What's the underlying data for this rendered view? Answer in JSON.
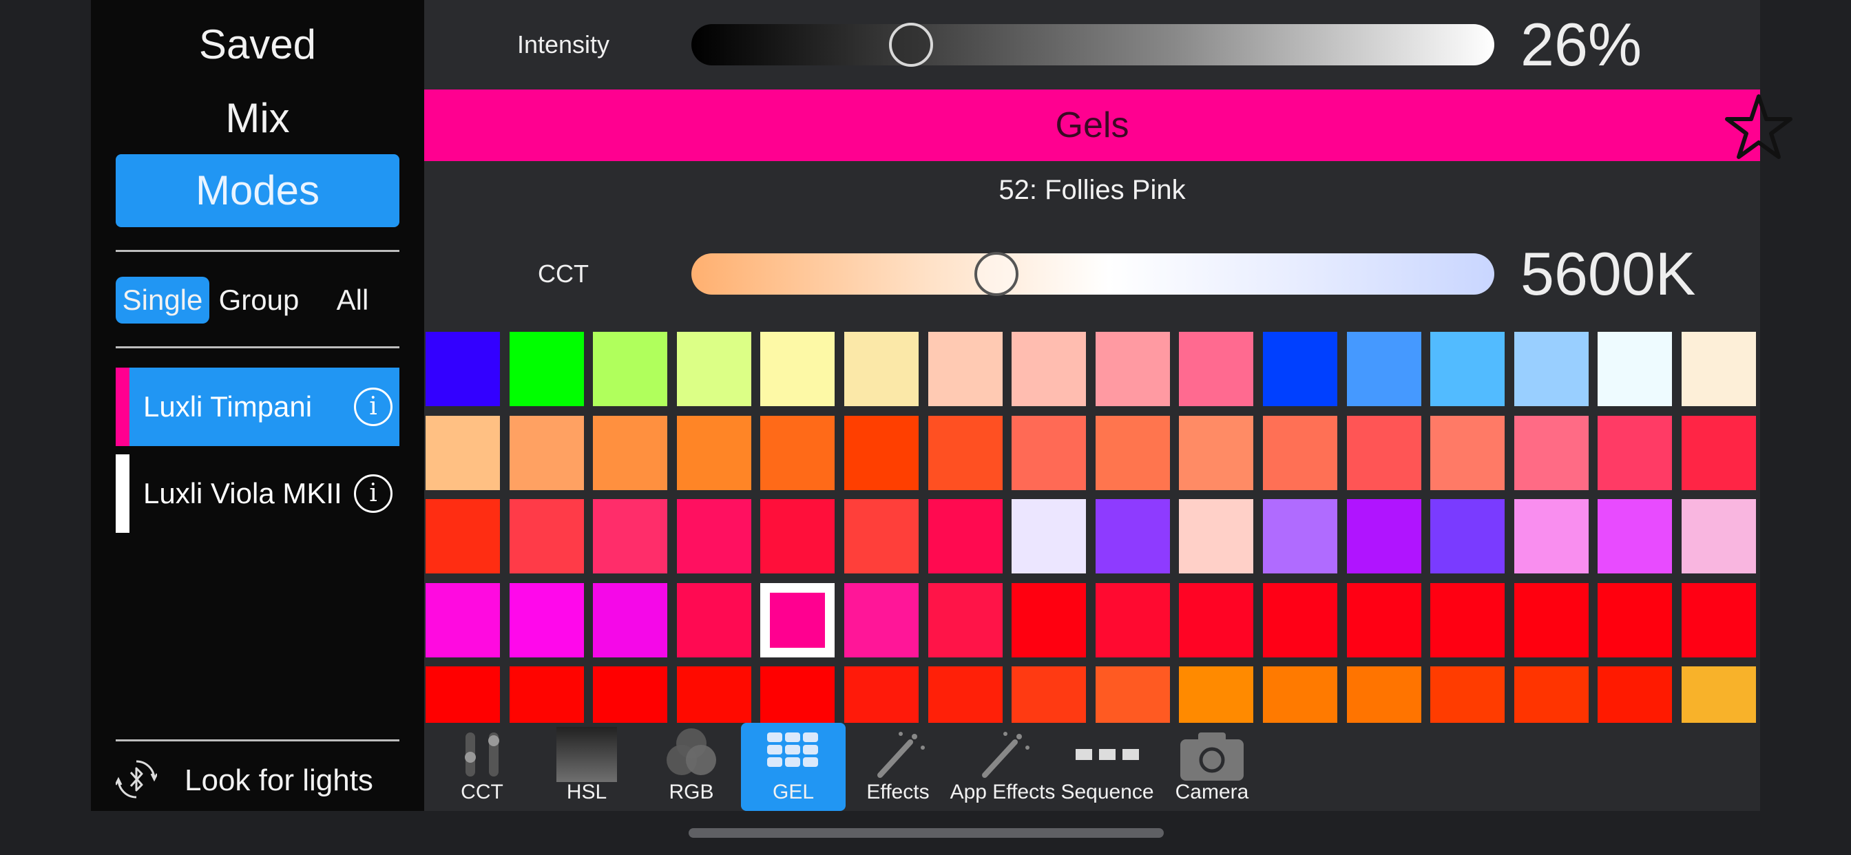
{
  "sidebar": {
    "nav": [
      {
        "label": "Saved",
        "active": false
      },
      {
        "label": "Mix",
        "active": false
      },
      {
        "label": "Modes",
        "active": true
      }
    ],
    "scope": [
      {
        "label": "Single",
        "active": true
      },
      {
        "label": "Group",
        "active": false
      },
      {
        "label": "All",
        "active": false
      }
    ],
    "lights": [
      {
        "name": "Luxli Timpani",
        "strip_color": "#ff0090",
        "selected": true
      },
      {
        "name": "Luxli Viola MKII",
        "strip_color": "#ffffff",
        "selected": false
      }
    ],
    "look_for_lights": "Look for lights",
    "info_glyph": "i"
  },
  "intensity": {
    "label": "Intensity",
    "value_text": "26%",
    "value": 0.26
  },
  "gels": {
    "title": "Gels",
    "selected_name": "52: Follies Pink",
    "favorite_icon": "star-outline-icon",
    "bar_color": "#ff0090"
  },
  "cct": {
    "label": "CCT",
    "value_text": "5600K",
    "value": 0.37
  },
  "swatches": [
    [
      "#3300ff",
      "#00ff00",
      "#b0ff5c",
      "#dcff86",
      "#fdf9a6",
      "#fbe8a8",
      "#ffcab3",
      "#ffbdb0",
      "#ff9aa2",
      "#ff6a90",
      "#0040ff",
      "#4599ff",
      "#52bbff",
      "#99cfff",
      "#eefbff",
      "#fdefd8"
    ],
    [
      "#ffc083",
      "#ffa162",
      "#ff903f",
      "#ff8526",
      "#ff6a18",
      "#ff3f00",
      "#ff5022",
      "#ff6a55",
      "#ff754e",
      "#ff8b65",
      "#ff7055",
      "#ff5555",
      "#ff7a66",
      "#ff6b85",
      "#ff3b65",
      "#ff2545"
    ],
    [
      "#ff2d12",
      "#ff3b48",
      "#ff2d6a",
      "#ff1060",
      "#ff0f3a",
      "#ff3f3a",
      "#ff0a50",
      "#ece6ff",
      "#8e3bff",
      "#ffd0c8",
      "#b06bff",
      "#b014ff",
      "#7a3bff",
      "#f98eef",
      "#e84bff",
      "#f9b6e0"
    ],
    [
      "#ff0ae0",
      "#ff08eb",
      "#f508e8",
      "#ff0a52",
      "#ff0090",
      "#ff1698",
      "#ff1448",
      "#ff0010",
      "#ff0a30",
      "#ff0424",
      "#ff0016",
      "#ff0014",
      "#ff0012",
      "#ff000f",
      "#ff000e",
      "#ff0014"
    ],
    [
      "#ff0000",
      "#ff0400",
      "#ff0000",
      "#ff0a00",
      "#ff0000",
      "#ff1a0a",
      "#ff2008",
      "#ff3a12",
      "#ff5a22",
      "#ff8a00",
      "#ff7a00",
      "#ff7400",
      "#ff3c00",
      "#ff3400",
      "#ff1a00",
      "#f8b22a"
    ]
  ],
  "selected_swatch": {
    "row": 3,
    "col": 4
  },
  "toolbar": [
    {
      "label": "CCT",
      "icon": "cct-sliders-icon",
      "active": false
    },
    {
      "label": "HSL",
      "icon": "hsl-gradient-icon",
      "active": false
    },
    {
      "label": "RGB",
      "icon": "rgb-circles-icon",
      "active": false
    },
    {
      "label": "GEL",
      "icon": "gel-grid-icon",
      "active": true
    },
    {
      "label": "Effects",
      "icon": "magic-wand-icon",
      "active": false
    },
    {
      "label": "App Effects",
      "icon": "magic-wand-icon",
      "active": false
    },
    {
      "label": "Sequence",
      "icon": "sequence-icon",
      "active": false
    },
    {
      "label": "Camera",
      "icon": "camera-icon",
      "active": false
    }
  ]
}
